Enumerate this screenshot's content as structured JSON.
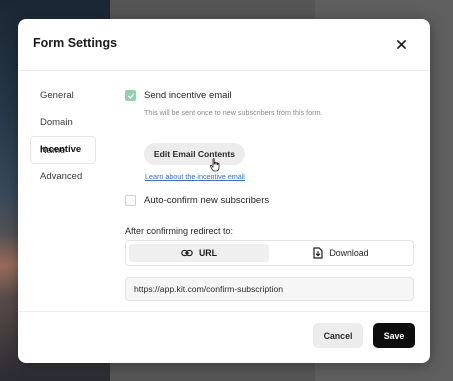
{
  "modal": {
    "title": "Form Settings",
    "close_icon": "close-icon"
  },
  "sidebar": {
    "items": [
      {
        "label": "General",
        "active": false
      },
      {
        "label": "Domain Name",
        "active": false
      },
      {
        "label": "Incentive",
        "active": true
      },
      {
        "label": "Advanced",
        "active": false
      }
    ]
  },
  "incentive": {
    "send_email_label": "Send incentive email",
    "send_email_checked": true,
    "send_email_help": "This will be sent once to new subscribers from this form.",
    "edit_button_label": "Edit Email Contents",
    "learn_link": "Learn about the incentive email",
    "auto_confirm_label": "Auto-confirm new subscribers",
    "auto_confirm_checked": false,
    "redirect_label": "After confirming redirect to:",
    "redirect_options": [
      {
        "label": "URL",
        "icon": "link-icon",
        "selected": true
      },
      {
        "label": "Download",
        "icon": "file-download-icon",
        "selected": false
      }
    ],
    "redirect_url_value": "https://app.kit.com/confirm-subscription"
  },
  "footer": {
    "cancel_label": "Cancel",
    "save_label": "Save"
  },
  "colors": {
    "checkbox_checked": "#8fd3a8",
    "save_button": "#0d0d0d",
    "link": "#3b6fbf"
  }
}
